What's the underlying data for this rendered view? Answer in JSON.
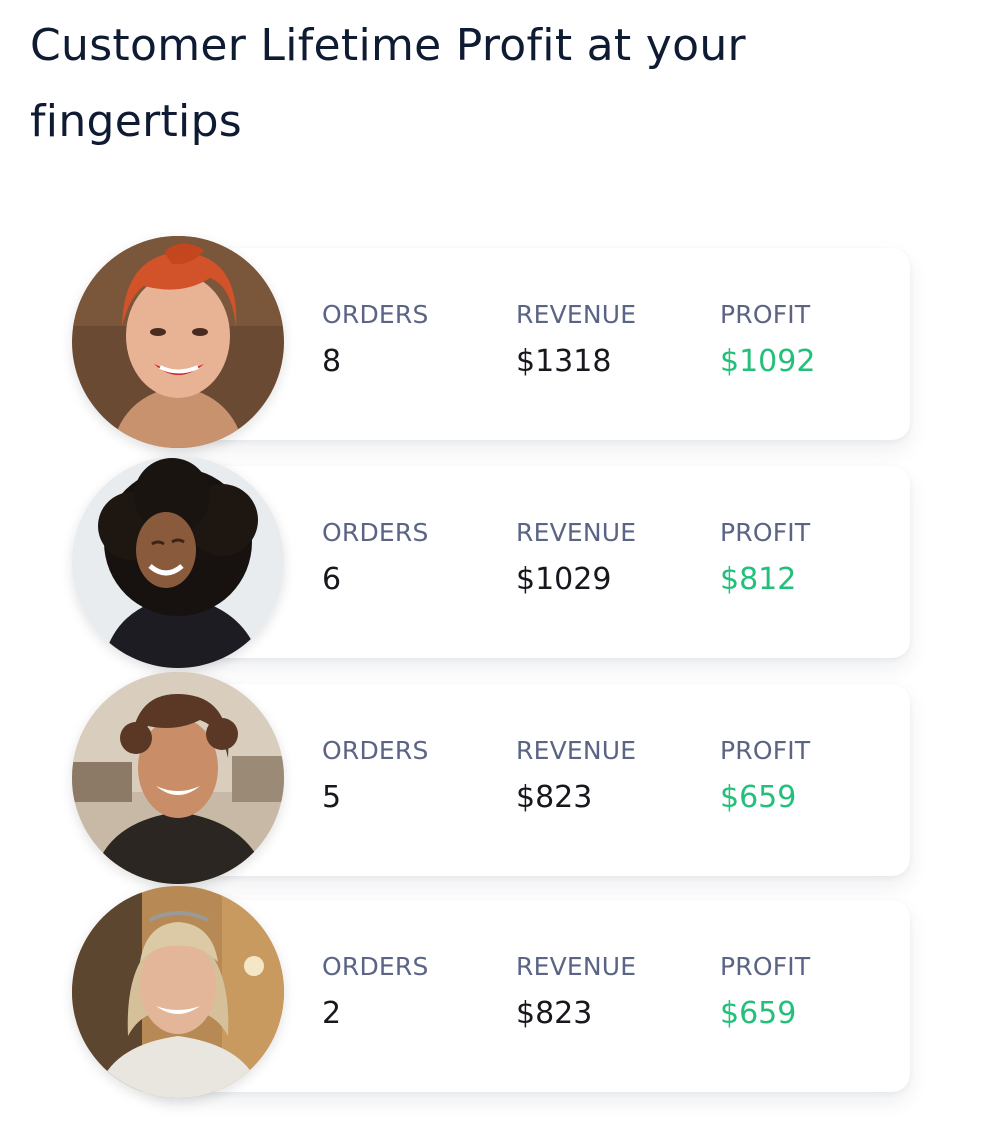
{
  "headline": "Customer Lifetime Profit at your fingertips",
  "labels": {
    "orders": "ORDERS",
    "revenue": "REVENUE",
    "profit": "PROFIT"
  },
  "colors": {
    "heading": "#0f1b33",
    "label": "#5b6485",
    "value": "#16181d",
    "profit": "#22c07a"
  },
  "customers": [
    {
      "avatar": "customer-photo-red-hair",
      "orders": "8",
      "revenue": "$1318",
      "profit": "$1092"
    },
    {
      "avatar": "customer-photo-curly-hair",
      "orders": "6",
      "revenue": "$1029",
      "profit": "$812"
    },
    {
      "avatar": "customer-photo-smiling-man",
      "orders": "5",
      "revenue": "$823",
      "profit": "$659"
    },
    {
      "avatar": "customer-photo-blonde-woman",
      "orders": "2",
      "revenue": "$823",
      "profit": "$659"
    }
  ]
}
